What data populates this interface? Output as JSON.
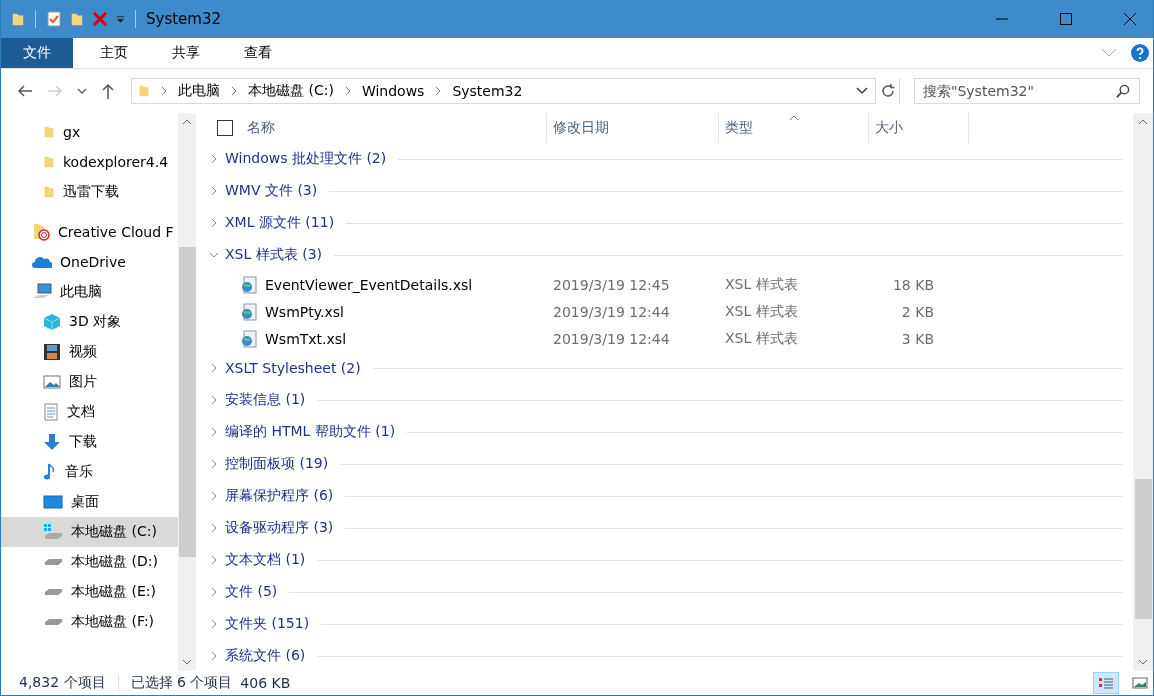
{
  "window": {
    "title": "System32"
  },
  "ribbon_tabs": [
    {
      "label": "文件",
      "selected": true
    },
    {
      "label": "主页",
      "selected": false
    },
    {
      "label": "共享",
      "selected": false
    },
    {
      "label": "查看",
      "selected": false
    }
  ],
  "address": {
    "breadcrumbs": [
      "此电脑",
      "本地磁盘 (C:)",
      "Windows",
      "System32"
    ]
  },
  "search": {
    "placeholder": "搜索\"System32\""
  },
  "quick_access": [
    {
      "label": "gx",
      "kind": "folder",
      "selected": false
    },
    {
      "label": "kodexplorer4.4",
      "kind": "folder",
      "selected": false
    },
    {
      "label": "迅雷下载",
      "kind": "folder",
      "selected": false
    }
  ],
  "nav_tree": [
    {
      "label": "Creative Cloud F",
      "kind": "creative-cloud",
      "selected": false
    },
    {
      "label": "OneDrive",
      "kind": "onedrive",
      "selected": false
    },
    {
      "label": "此电脑",
      "kind": "pc",
      "selected": false,
      "children": [
        {
          "label": "3D 对象",
          "kind": "cube",
          "selected": false
        },
        {
          "label": "视频",
          "kind": "video",
          "selected": false
        },
        {
          "label": "图片",
          "kind": "picture",
          "selected": false
        },
        {
          "label": "文档",
          "kind": "document",
          "selected": false
        },
        {
          "label": "下载",
          "kind": "download",
          "selected": false
        },
        {
          "label": "音乐",
          "kind": "music",
          "selected": false
        },
        {
          "label": "桌面",
          "kind": "desktop",
          "selected": false
        },
        {
          "label": "本地磁盘 (C:)",
          "kind": "drive-windows",
          "selected": true
        },
        {
          "label": "本地磁盘 (D:)",
          "kind": "drive",
          "selected": false
        },
        {
          "label": "本地磁盘 (E:)",
          "kind": "drive",
          "selected": false
        },
        {
          "label": "本地磁盘 (F:)",
          "kind": "drive",
          "selected": false
        }
      ]
    }
  ],
  "select_all": {
    "checked": false
  },
  "columns": [
    "名称",
    "修改日期",
    "类型",
    "大小"
  ],
  "groups": [
    {
      "label": "Windows 批处理文件 (2)",
      "expanded": false
    },
    {
      "label": "WMV 文件 (3)",
      "expanded": false
    },
    {
      "label": "XML 源文件 (11)",
      "expanded": false
    },
    {
      "label": "XSL 样式表 (3)",
      "expanded": true,
      "files": [
        {
          "name": "EventViewer_EventDetails.xsl",
          "modified": "2019/3/19 12:45",
          "type": "XSL 样式表",
          "size": "18 KB"
        },
        {
          "name": "WsmPty.xsl",
          "modified": "2019/3/19 12:44",
          "type": "XSL 样式表",
          "size": "2 KB"
        },
        {
          "name": "WsmTxt.xsl",
          "modified": "2019/3/19 12:44",
          "type": "XSL 样式表",
          "size": "3 KB"
        }
      ]
    },
    {
      "label": "XSLT Stylesheet (2)",
      "expanded": false
    },
    {
      "label": "安装信息 (1)",
      "expanded": false
    },
    {
      "label": "编译的 HTML 帮助文件 (1)",
      "expanded": false
    },
    {
      "label": "控制面板项 (19)",
      "expanded": false
    },
    {
      "label": "屏幕保护程序 (6)",
      "expanded": false
    },
    {
      "label": "设备驱动程序 (3)",
      "expanded": false
    },
    {
      "label": "文本文档 (1)",
      "expanded": false
    },
    {
      "label": "文件 (5)",
      "expanded": false
    },
    {
      "label": "文件夹 (151)",
      "expanded": false
    },
    {
      "label": "系统文件 (6)",
      "expanded": false
    }
  ],
  "status_bar": {
    "item_count": "4,832 个项目",
    "selection": "已选择 6 个项目",
    "selection_size": "406 KB"
  }
}
